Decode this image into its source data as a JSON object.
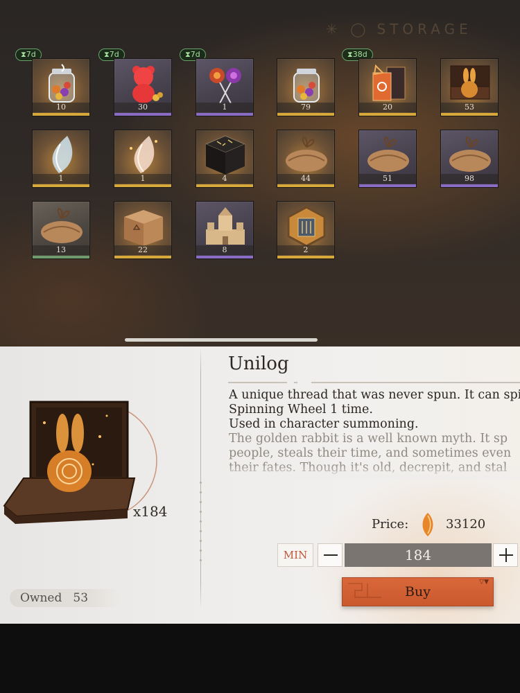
{
  "storage": {
    "title": "STORAGE",
    "timers": [
      "7d",
      "7d",
      "7d",
      "38d"
    ],
    "items": [
      {
        "id": "candy-jar",
        "qty": "10",
        "rarity": "gold"
      },
      {
        "id": "gummy-bear",
        "qty": "30",
        "rarity": "purple"
      },
      {
        "id": "lollipops",
        "qty": "1",
        "rarity": "purple"
      },
      {
        "id": "candy-jar",
        "qty": "79",
        "rarity": "gold"
      },
      {
        "id": "music-box-book",
        "qty": "20",
        "rarity": "gold"
      },
      {
        "id": "rabbit-box",
        "qty": "53",
        "rarity": "gold"
      },
      {
        "id": "silver-thread-wisp",
        "qty": "1",
        "rarity": "gold"
      },
      {
        "id": "golden-thread-wisp",
        "qty": "1",
        "rarity": "gold"
      },
      {
        "id": "rune-chest",
        "qty": "4",
        "rarity": "gold"
      },
      {
        "id": "parcel",
        "qty": "44",
        "rarity": "gold"
      },
      {
        "id": "parcel",
        "qty": "51",
        "rarity": "purple"
      },
      {
        "id": "parcel",
        "qty": "98",
        "rarity": "purple"
      },
      {
        "id": "parcel",
        "qty": "13",
        "rarity": "green"
      },
      {
        "id": "wooden-crate",
        "qty": "22",
        "rarity": "gold"
      },
      {
        "id": "sand-castle",
        "qty": "8",
        "rarity": "purple"
      },
      {
        "id": "hex-emblem",
        "qty": "2",
        "rarity": "gold"
      }
    ]
  },
  "detail": {
    "name": "Unilog",
    "desc_lines": [
      "A unique thread that was never spun. It can spin",
      "Spinning Wheel 1 time.",
      "Used in character summoning."
    ],
    "lore_lines": [
      "The golden rabbit is a well known myth. It sp",
      "people, steals their time, and sometimes even",
      "their fates. Though it's old, decrepit, and stal"
    ],
    "count_label": "x184",
    "owned_label": "Owned",
    "owned_value": "53",
    "price_label": "Price:",
    "price_value": "33120",
    "min_label": "MIN",
    "quantity": "184",
    "buy_label": "Buy",
    "buy_corner": "▽▼",
    "icons": {
      "currency": "amber-gem-icon",
      "minus": "minus-icon",
      "plus": "plus-icon"
    },
    "colors": {
      "accent": "#d9673a",
      "min_text": "#c2553a"
    }
  }
}
